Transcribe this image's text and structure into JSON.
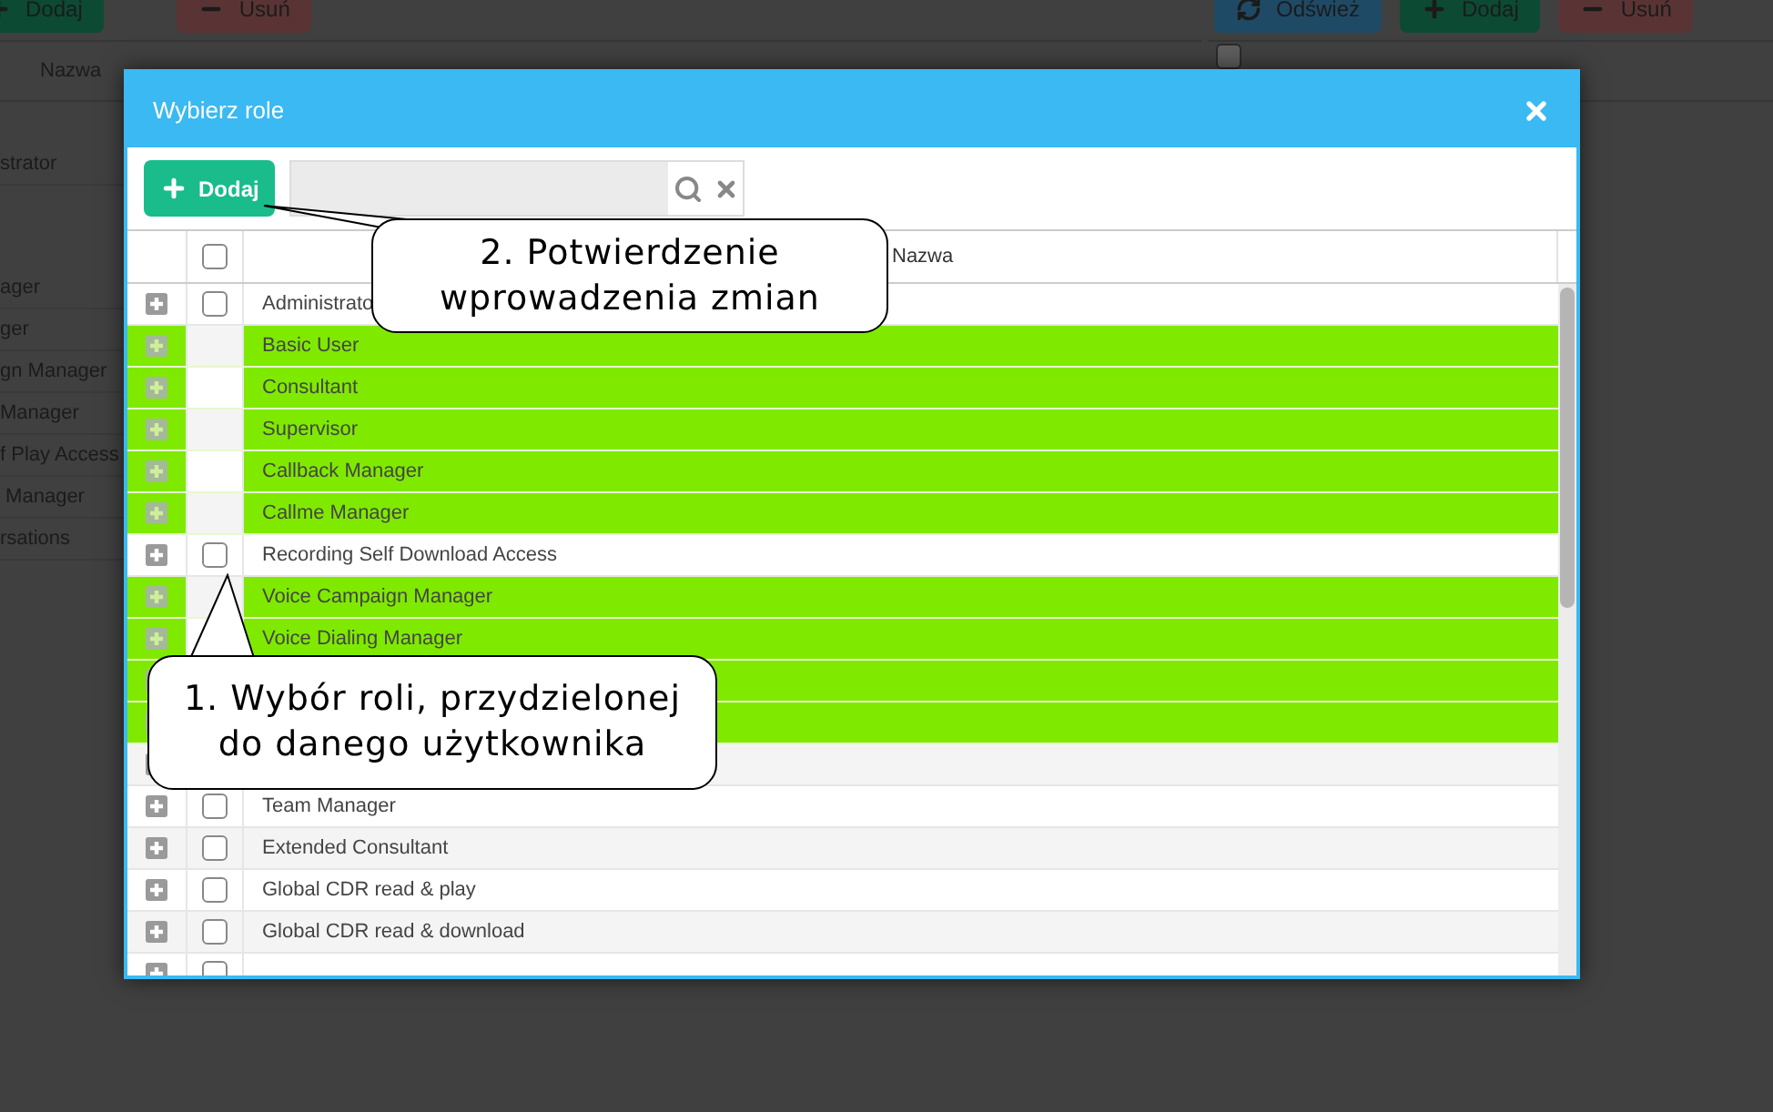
{
  "background": {
    "toolbar_left": [
      {
        "label": "Dodaj",
        "kind": "add"
      },
      {
        "label": "Usuń",
        "kind": "delete"
      }
    ],
    "toolbar_right": [
      {
        "label": "Odśwież",
        "kind": "refresh"
      },
      {
        "label": "Dodaj",
        "kind": "add"
      },
      {
        "label": "Usuń",
        "kind": "delete"
      }
    ],
    "left_column": "Nazwa",
    "right_header_checked": false,
    "left_rows": [
      "strator",
      "ager",
      "ger",
      "gn Manager",
      "Manager",
      "f Play Access",
      " Manager",
      "rsations"
    ]
  },
  "dialog": {
    "title": "Wybierz role",
    "add_button": "Dodaj",
    "column": "Nazwa",
    "header_checked": false,
    "rows": [
      {
        "name": "Administrato",
        "selected": false
      },
      {
        "name": "Basic User",
        "selected": true
      },
      {
        "name": "Consultant",
        "selected": true
      },
      {
        "name": "Supervisor",
        "selected": true
      },
      {
        "name": "Callback Manager",
        "selected": true
      },
      {
        "name": "Callme Manager",
        "selected": true
      },
      {
        "name": "Recording Self Download Access",
        "selected": false
      },
      {
        "name": "Voice Campaign Manager",
        "selected": true
      },
      {
        "name": "Voice Dialing Manager",
        "selected": true
      },
      {
        "selected": true
      },
      {
        "selected": true
      },
      {
        "selected": false
      },
      {
        "name": "Team Manager",
        "selected": false
      },
      {
        "name": "Extended Consultant",
        "selected": false
      },
      {
        "name": "Global CDR read & play",
        "selected": false
      },
      {
        "name": "Global CDR read & download",
        "selected": false
      },
      {
        "selected": false
      }
    ]
  },
  "callouts": [
    {
      "text": "2. Potwierdzenie wprowadzenia zmian",
      "kind": "confirm"
    },
    {
      "text": "1. Wybór roli, przydzielonej do danego użytkownika",
      "kind": "select"
    }
  ]
}
